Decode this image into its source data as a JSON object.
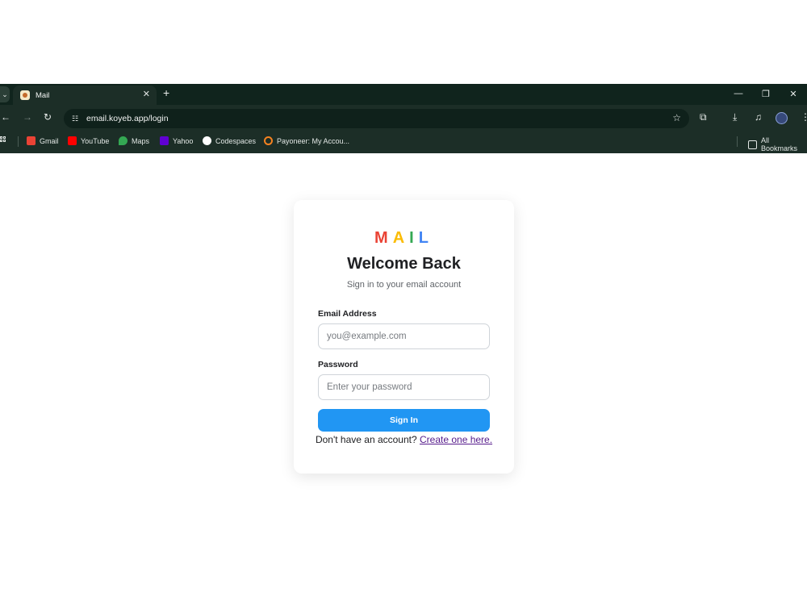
{
  "browser": {
    "tab_title": "Mail",
    "url": "email.koyeb.app/login",
    "bookmarks": [
      {
        "label": "Gmail",
        "color": "#ea4335"
      },
      {
        "label": "YouTube",
        "color": "#ff0000"
      },
      {
        "label": "Maps",
        "color": "#34a853"
      },
      {
        "label": "Yahoo",
        "color": "#6001d2"
      },
      {
        "label": "Codespaces",
        "color": "#ffffff"
      },
      {
        "label": "Payoneer: My Accou...",
        "color": "#f58220"
      }
    ],
    "all_bookmarks": "All Bookmarks"
  },
  "login": {
    "logo_letters": [
      {
        "char": "M",
        "color": "#ea4335"
      },
      {
        "char": "A",
        "color": "#fbbc05"
      },
      {
        "char": "I",
        "color": "#34a853"
      },
      {
        "char": "L",
        "color": "#4285f4"
      }
    ],
    "title": "Welcome Back",
    "subtitle": "Sign in to your email account",
    "email_label": "Email Address",
    "email_placeholder": "you@example.com",
    "password_label": "Password",
    "password_placeholder": "Enter your password",
    "submit_label": "Sign In",
    "footer_text": "Don't have an account?",
    "footer_link": "Create one here."
  },
  "colors": {
    "primary": "#2196f3",
    "browser_chrome": "#1c2e27"
  }
}
